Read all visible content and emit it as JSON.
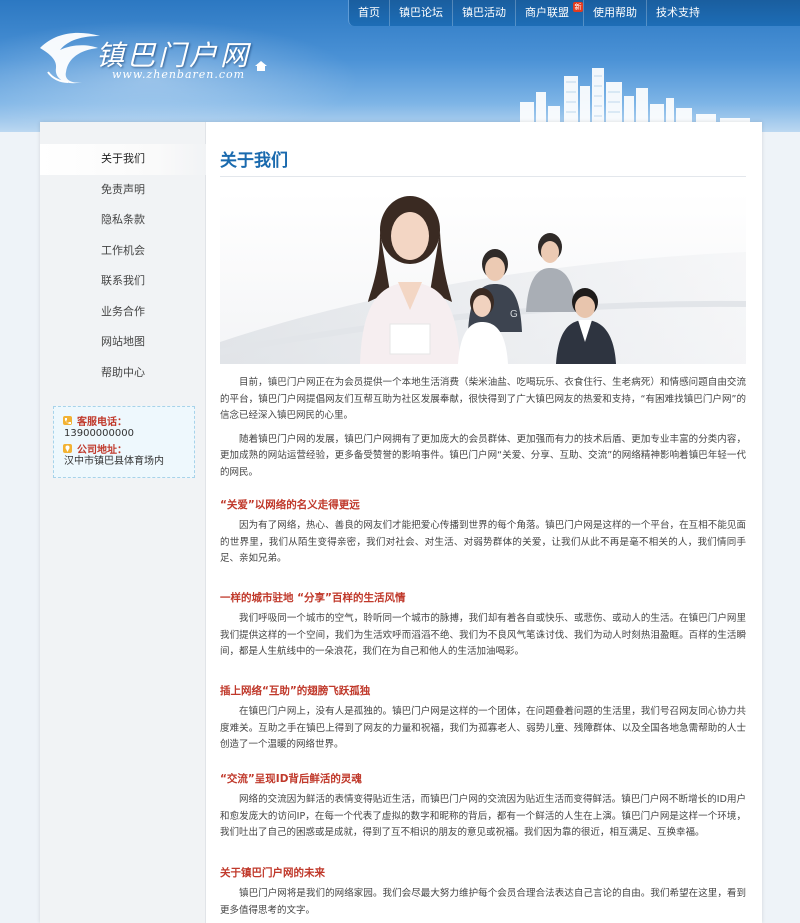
{
  "header": {
    "nav": [
      {
        "label": "首页",
        "badge": ""
      },
      {
        "label": "镇巴论坛",
        "badge": ""
      },
      {
        "label": "镇巴活动",
        "badge": ""
      },
      {
        "label": "商户联盟",
        "badge": "新"
      },
      {
        "label": "使用帮助",
        "badge": ""
      },
      {
        "label": "技术支持",
        "badge": ""
      }
    ],
    "logo_title": "镇巴门户网",
    "logo_url": "www.zhenbaren.com",
    "colors": {
      "nav_bg": "#1d6db6",
      "header_top": "#2c78c2",
      "header_bottom": "#bcd8f1"
    }
  },
  "sidebar": {
    "items": [
      {
        "label": "关于我们"
      },
      {
        "label": "免责声明"
      },
      {
        "label": "隐私条款"
      },
      {
        "label": "工作机会"
      },
      {
        "label": "联系我们"
      },
      {
        "label": "业务合作"
      },
      {
        "label": "网站地图"
      },
      {
        "label": "帮助中心"
      }
    ],
    "contact": {
      "phone_label": "客服电话：",
      "phone_value": "13900000000",
      "address_label": "公司地址：",
      "address_value": "汉中市镇巴县体育场内"
    }
  },
  "main": {
    "title": "关于我们",
    "intro": [
      "目前，镇巴门户网正在为会员提供一个本地生活消费（柴米油盐、吃喝玩乐、衣食住行、生老病死）和情感问题自由交流的平台，镇巴门户网提倡网友们互帮互助为社区发展奉献，很快得到了广大镇巴网友的热爱和支持，“有困难找镇巴门户网”的信念已经深入镇巴网民的心里。",
      "随着镇巴门户网的发展，镇巴门户网拥有了更加庞大的会员群体、更加强而有力的技术后盾、更加专业丰富的分类内容，更加成熟的网站运营经验，更多备受赞誉的影响事件。镇巴门户网“关爱、分享、互助、交流”的网络精神影响着镇巴年轻一代的网民。"
    ],
    "sections": [
      {
        "heading": "“关爱”以网络的名义走得更远",
        "text": "因为有了网络，热心、善良的网友们才能把爱心传播到世界的每个角落。镇巴门户网是这样的一个平台，在互相不能见面的世界里，我们从陌生变得亲密，我们对社会、对生活、对弱势群体的关爱，让我们从此不再是毫不相关的人，我们情同手足、亲如兄弟。"
      },
      {
        "heading": "一样的城市驻地 “分享”百样的生活风情",
        "text": "我们呼吸同一个城市的空气，聆听同一个城市的脉搏，我们却有着各自或快乐、或悲伤、或动人的生活。在镇巴门户网里我们提供这样的一个空间，我们为生活欢呼而滔滔不绝、我们为不良风气笔诛讨伐、我们为动人时刻热泪盈眶。百样的生活瞬间，都是人生航线中的一朵浪花，我们在为自己和他人的生活加油喝彩。"
      },
      {
        "heading": "插上网络“互助”的翅膀飞跃孤独",
        "text": "在镇巴门户网上，没有人是孤独的。镇巴门户网是这样的一个团体，在问题叠着问题的生活里，我们号召网友同心协力共度难关。互助之手在镇巴上得到了网友的力量和祝福，我们为孤寡老人、弱势儿童、残障群体、以及全国各地急需帮助的人士创造了一个温暖的网络世界。"
      },
      {
        "heading": "“交流”呈现ID背后鲜活的灵魂",
        "text": "网络的交流因为鲜活的表情变得贴近生活，而镇巴门户网的交流因为贴近生活而变得鲜活。镇巴门户网不断增长的ID用户和愈发庞大的访问IP，在每一个代表了虚拟的数字和昵称的背后，都有一个鲜活的人生在上演。镇巴门户网是这样一个环境，我们吐出了自己的困惑或是成就，得到了互不相识的朋友的意见或祝福。我们因为靠的很近，相互满足、互换幸福。"
      },
      {
        "heading": "关于镇巴门户网的未来",
        "text": "镇巴门户网将是我们的网络家园。我们会尽最大努力维护每个会员合理合法表达自己言论的自由。我们希望在这里，看到更多值得思考的文字。"
      }
    ]
  }
}
